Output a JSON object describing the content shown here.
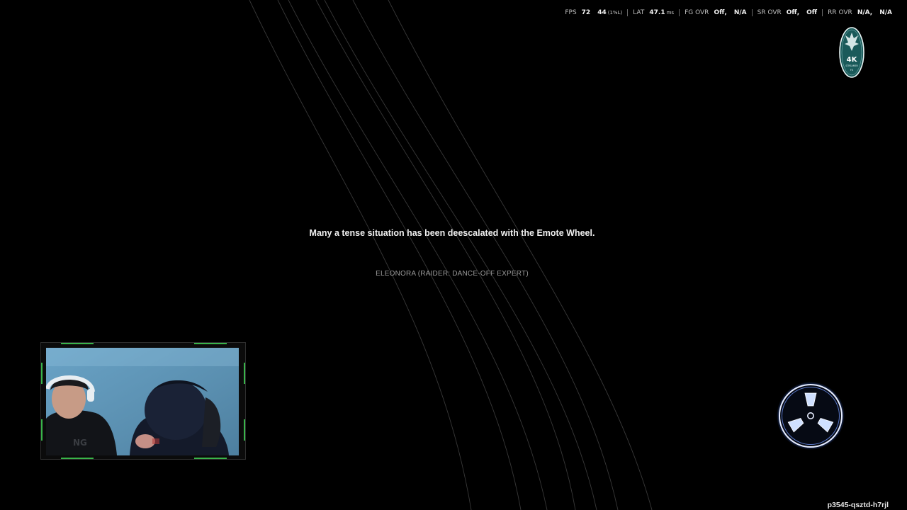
{
  "perf_overlay": {
    "fps": {
      "label": "FPS",
      "value": "72",
      "low_value": "44",
      "low_label": "(1%L)"
    },
    "latency": {
      "label": "LAT",
      "value": "47.1",
      "unit": "ms"
    },
    "frame_gen": {
      "label": "FG OVR",
      "value_a": "Off,",
      "value_b": "N/A"
    },
    "super_res": {
      "label": "SR OVR",
      "value_a": "Off,",
      "value_b": "Off"
    },
    "ray_recon": {
      "label": "RR OVR",
      "value_a": "N/A,",
      "value_b": "N/A"
    }
  },
  "badge": {
    "text_main": "4K",
    "text_sub": "STREAMER",
    "text_tiny": "FX",
    "color": "#1a5a5a"
  },
  "loading_screen": {
    "tip": "Many a tense situation has been deescalated with the Emote Wheel.",
    "author": "ELEONORA (RAIDER: DANCE-OFF EXPERT)"
  },
  "webcam": {
    "frame_accent_color": "#39b54a",
    "background_color": "#5a8fb0",
    "shirt_text": "NG"
  },
  "spinner": {
    "icon": "loading-spinner-icon",
    "glow_color": "#4a7fff"
  },
  "session_id": "p3545-qsztd-h7rjl"
}
